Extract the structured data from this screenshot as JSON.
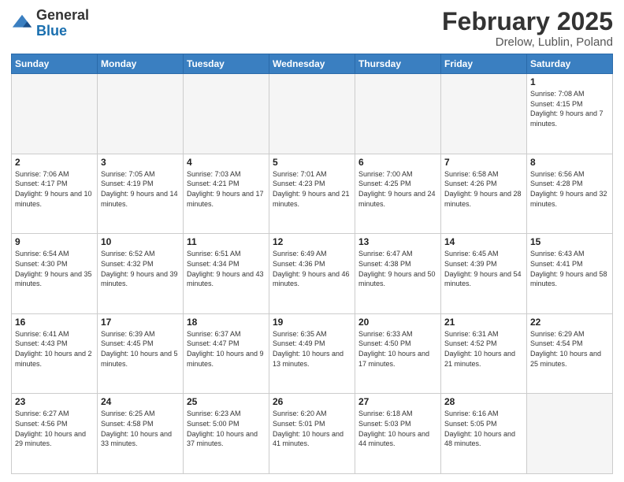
{
  "header": {
    "logo_general": "General",
    "logo_blue": "Blue",
    "month_year": "February 2025",
    "location": "Drelow, Lublin, Poland"
  },
  "days_of_week": [
    "Sunday",
    "Monday",
    "Tuesday",
    "Wednesday",
    "Thursday",
    "Friday",
    "Saturday"
  ],
  "weeks": [
    [
      {
        "day": "",
        "info": ""
      },
      {
        "day": "",
        "info": ""
      },
      {
        "day": "",
        "info": ""
      },
      {
        "day": "",
        "info": ""
      },
      {
        "day": "",
        "info": ""
      },
      {
        "day": "",
        "info": ""
      },
      {
        "day": "1",
        "info": "Sunrise: 7:08 AM\nSunset: 4:15 PM\nDaylight: 9 hours and 7 minutes."
      }
    ],
    [
      {
        "day": "2",
        "info": "Sunrise: 7:06 AM\nSunset: 4:17 PM\nDaylight: 9 hours and 10 minutes."
      },
      {
        "day": "3",
        "info": "Sunrise: 7:05 AM\nSunset: 4:19 PM\nDaylight: 9 hours and 14 minutes."
      },
      {
        "day": "4",
        "info": "Sunrise: 7:03 AM\nSunset: 4:21 PM\nDaylight: 9 hours and 17 minutes."
      },
      {
        "day": "5",
        "info": "Sunrise: 7:01 AM\nSunset: 4:23 PM\nDaylight: 9 hours and 21 minutes."
      },
      {
        "day": "6",
        "info": "Sunrise: 7:00 AM\nSunset: 4:25 PM\nDaylight: 9 hours and 24 minutes."
      },
      {
        "day": "7",
        "info": "Sunrise: 6:58 AM\nSunset: 4:26 PM\nDaylight: 9 hours and 28 minutes."
      },
      {
        "day": "8",
        "info": "Sunrise: 6:56 AM\nSunset: 4:28 PM\nDaylight: 9 hours and 32 minutes."
      }
    ],
    [
      {
        "day": "9",
        "info": "Sunrise: 6:54 AM\nSunset: 4:30 PM\nDaylight: 9 hours and 35 minutes."
      },
      {
        "day": "10",
        "info": "Sunrise: 6:52 AM\nSunset: 4:32 PM\nDaylight: 9 hours and 39 minutes."
      },
      {
        "day": "11",
        "info": "Sunrise: 6:51 AM\nSunset: 4:34 PM\nDaylight: 9 hours and 43 minutes."
      },
      {
        "day": "12",
        "info": "Sunrise: 6:49 AM\nSunset: 4:36 PM\nDaylight: 9 hours and 46 minutes."
      },
      {
        "day": "13",
        "info": "Sunrise: 6:47 AM\nSunset: 4:38 PM\nDaylight: 9 hours and 50 minutes."
      },
      {
        "day": "14",
        "info": "Sunrise: 6:45 AM\nSunset: 4:39 PM\nDaylight: 9 hours and 54 minutes."
      },
      {
        "day": "15",
        "info": "Sunrise: 6:43 AM\nSunset: 4:41 PM\nDaylight: 9 hours and 58 minutes."
      }
    ],
    [
      {
        "day": "16",
        "info": "Sunrise: 6:41 AM\nSunset: 4:43 PM\nDaylight: 10 hours and 2 minutes."
      },
      {
        "day": "17",
        "info": "Sunrise: 6:39 AM\nSunset: 4:45 PM\nDaylight: 10 hours and 5 minutes."
      },
      {
        "day": "18",
        "info": "Sunrise: 6:37 AM\nSunset: 4:47 PM\nDaylight: 10 hours and 9 minutes."
      },
      {
        "day": "19",
        "info": "Sunrise: 6:35 AM\nSunset: 4:49 PM\nDaylight: 10 hours and 13 minutes."
      },
      {
        "day": "20",
        "info": "Sunrise: 6:33 AM\nSunset: 4:50 PM\nDaylight: 10 hours and 17 minutes."
      },
      {
        "day": "21",
        "info": "Sunrise: 6:31 AM\nSunset: 4:52 PM\nDaylight: 10 hours and 21 minutes."
      },
      {
        "day": "22",
        "info": "Sunrise: 6:29 AM\nSunset: 4:54 PM\nDaylight: 10 hours and 25 minutes."
      }
    ],
    [
      {
        "day": "23",
        "info": "Sunrise: 6:27 AM\nSunset: 4:56 PM\nDaylight: 10 hours and 29 minutes."
      },
      {
        "day": "24",
        "info": "Sunrise: 6:25 AM\nSunset: 4:58 PM\nDaylight: 10 hours and 33 minutes."
      },
      {
        "day": "25",
        "info": "Sunrise: 6:23 AM\nSunset: 5:00 PM\nDaylight: 10 hours and 37 minutes."
      },
      {
        "day": "26",
        "info": "Sunrise: 6:20 AM\nSunset: 5:01 PM\nDaylight: 10 hours and 41 minutes."
      },
      {
        "day": "27",
        "info": "Sunrise: 6:18 AM\nSunset: 5:03 PM\nDaylight: 10 hours and 44 minutes."
      },
      {
        "day": "28",
        "info": "Sunrise: 6:16 AM\nSunset: 5:05 PM\nDaylight: 10 hours and 48 minutes."
      },
      {
        "day": "",
        "info": ""
      }
    ]
  ]
}
